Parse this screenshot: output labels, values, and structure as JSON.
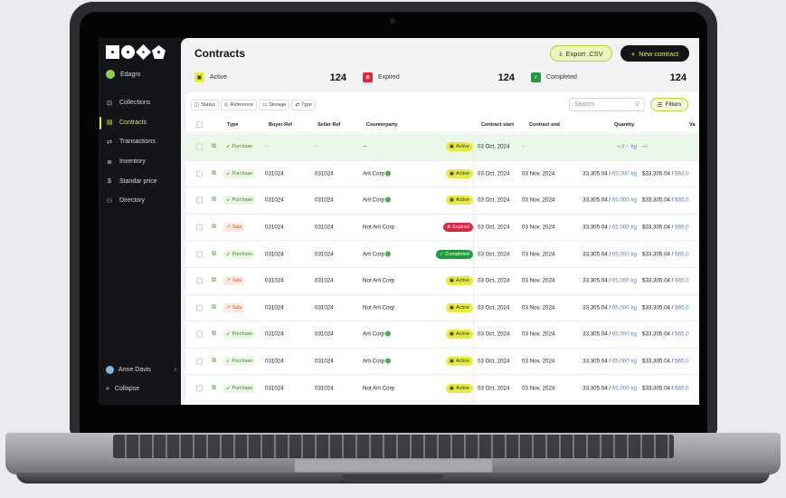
{
  "sidebar": {
    "org": "Edagro",
    "items": [
      {
        "label": "Collections",
        "icon": "box-icon",
        "glyph": "⊡"
      },
      {
        "label": "Contracts",
        "icon": "document-icon",
        "glyph": "▤",
        "active": true
      },
      {
        "label": "Transactions",
        "icon": "swap-icon",
        "glyph": "⇄"
      },
      {
        "label": "Inventory",
        "icon": "inventory-icon",
        "glyph": "≣"
      },
      {
        "label": "Standar price",
        "icon": "dollar-icon",
        "glyph": "$"
      },
      {
        "label": "Directory",
        "icon": "users-icon",
        "glyph": "⚇"
      }
    ],
    "user": "Anne Davis",
    "collapse": "Collapse"
  },
  "header": {
    "title": "Contracts",
    "export_label": "Export .CSV",
    "new_label": "New contract"
  },
  "stats": [
    {
      "label": "Active",
      "value": "124",
      "color": "#e7ec3c"
    },
    {
      "label": "Expired",
      "value": "124",
      "color": "#d9283f"
    },
    {
      "label": "Completed",
      "value": "124",
      "color": "#1f9a3f"
    }
  ],
  "toolbar": {
    "chips": [
      "Status",
      "Reference",
      "Storage",
      "Type"
    ],
    "search_placeholder": "Search",
    "filters_label": "Filters"
  },
  "table": {
    "columns": [
      "Type",
      "Buyer Ref",
      "Seller Ref",
      "Counterparty",
      "Contract start",
      "Contract end",
      "Quantity",
      "Va"
    ],
    "rows": [
      {
        "type": "Purchase",
        "buyer": "--",
        "seller": "--",
        "party": "--",
        "status": "Active",
        "start": "03 Oct, 2024",
        "end": "--",
        "qty": "-- / ",
        "qty_unit": "-- kg",
        "value": "--",
        "value_unit": "/",
        "highlight": true,
        "verified": false
      },
      {
        "type": "Purchase",
        "buyer": "031024",
        "seller": "031024",
        "party": "Arli Corp",
        "status": "Active",
        "start": "03 Oct, 2024",
        "end": "03 Nov, 2024",
        "qty": "33,305.04 / ",
        "qty_unit": "65,000 kg",
        "value": "$33,305.04 / ",
        "value_unit": "$65,0",
        "verified": true
      },
      {
        "type": "Purchase",
        "buyer": "031024",
        "seller": "031024",
        "party": "Arli Corp",
        "status": "Active",
        "start": "03 Oct, 2024",
        "end": "03 Nov, 2024",
        "qty": "33,305.04 / ",
        "qty_unit": "65,000 kg",
        "value": "$33,305.04 / ",
        "value_unit": "$65,0",
        "verified": true
      },
      {
        "type": "Sale",
        "buyer": "031024",
        "seller": "031024",
        "party": "Not Arli Corp",
        "status": "Expired",
        "start": "03 Oct, 2024",
        "end": "03 Nov, 2024",
        "qty": "33,305.04 / ",
        "qty_unit": "65,000 kg",
        "value": "$33,305.04 / ",
        "value_unit": "$65,0",
        "verified": false
      },
      {
        "type": "Purchase",
        "buyer": "031024",
        "seller": "031024",
        "party": "Arli Corp",
        "status": "Completed",
        "start": "03 Oct, 2024",
        "end": "03 Nov, 2024",
        "qty": "33,305.04 / ",
        "qty_unit": "65,000 kg",
        "value": "$33,305.04 / ",
        "value_unit": "$65,0",
        "verified": true
      },
      {
        "type": "Sale",
        "buyer": "031024",
        "seller": "031024",
        "party": "Not Arli Corp",
        "status": "Active",
        "start": "03 Oct, 2024",
        "end": "03 Nov, 2024",
        "qty": "33,305.04 / ",
        "qty_unit": "65,000 kg",
        "value": "$33,305.04 / ",
        "value_unit": "$65,0",
        "verified": false
      },
      {
        "type": "Sale",
        "buyer": "031024",
        "seller": "031024",
        "party": "Not Arli Corp",
        "status": "Active",
        "start": "03 Oct, 2024",
        "end": "03 Nov, 2024",
        "qty": "33,305.04 / ",
        "qty_unit": "65,000 kg",
        "value": "$33,305.04 / ",
        "value_unit": "$65,0",
        "verified": false
      },
      {
        "type": "Purchase",
        "buyer": "031024",
        "seller": "031024",
        "party": "Arli Corp",
        "status": "Active",
        "start": "03 Oct, 2024",
        "end": "03 Nov, 2024",
        "qty": "33,305.04 / ",
        "qty_unit": "65,000 kg",
        "value": "$33,305.04 / ",
        "value_unit": "$65,0",
        "verified": true
      },
      {
        "type": "Purchase",
        "buyer": "031024",
        "seller": "031024",
        "party": "Arli Corp",
        "status": "Active",
        "start": "03 Oct, 2024",
        "end": "03 Nov, 2024",
        "qty": "33,305.04 / ",
        "qty_unit": "65,000 kg",
        "value": "$33,305.04 / ",
        "value_unit": "$65,0",
        "verified": true
      },
      {
        "type": "Purchase",
        "buyer": "031024",
        "seller": "031024",
        "party": "Not Arli Corp",
        "status": "Active",
        "start": "03 Oct, 2024",
        "end": "03 Nov, 2024",
        "qty": "33,305.04 / ",
        "qty_unit": "65,000 kg",
        "value": "$33,305.04 / ",
        "value_unit": "$65,0",
        "verified": false
      }
    ]
  }
}
